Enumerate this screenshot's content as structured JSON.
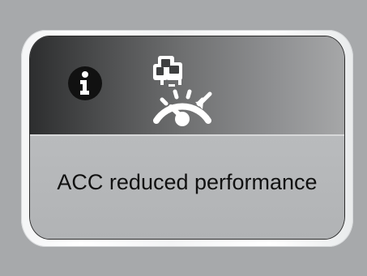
{
  "message": {
    "text": "ACC reduced performance"
  },
  "icons": {
    "info": "info-icon",
    "acc": "adaptive-cruise-control-icon"
  },
  "colors": {
    "background": "#a7a9ab",
    "frame": "#f3f4f5",
    "screen_top": "#4b4c4d",
    "screen_bottom": "#b6b8ba",
    "text": "#111111",
    "icon": "#ffffff"
  }
}
